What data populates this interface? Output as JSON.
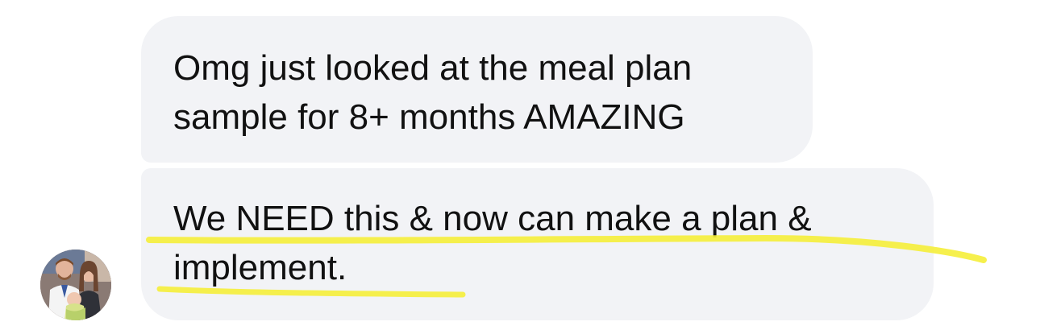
{
  "messages": [
    {
      "lines": [
        "Omg just looked at the meal plan",
        "sample for 8+ months AMAZING"
      ]
    },
    {
      "lines": [
        "We NEED this & now can make a plan &",
        "implement."
      ]
    }
  ],
  "avatar": {
    "description_icon": "couple-photo-avatar"
  },
  "colors": {
    "bubble_background": "#f2f3f6",
    "text": "#111111",
    "highlighter": "#f5ee3a"
  }
}
